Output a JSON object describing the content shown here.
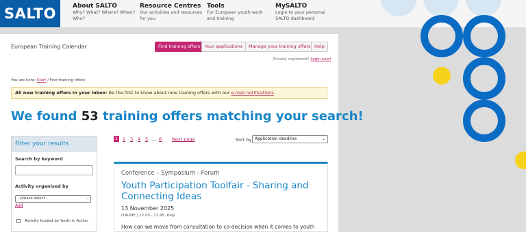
{
  "brand": {
    "logo_text": "SALTO",
    "color": "#0a5ea8",
    "accent": "#c42670",
    "link": "#1a86c8"
  },
  "nav": [
    {
      "title": "About SALTO",
      "sub1": "Why? What? Where? When?",
      "sub2": "Who?"
    },
    {
      "title": "Resource Centres",
      "sub1": "Our activities and resources",
      "sub2": "for you"
    },
    {
      "title": "Tools",
      "sub1": "For European youth work",
      "sub2": "and training"
    },
    {
      "title": "MySALTO",
      "sub1": "Login to your personal",
      "sub2": "SALTO dashboard"
    }
  ],
  "page": {
    "section_title": "European Training Calendar",
    "buttons": {
      "find": "Find training offers",
      "applications": "Your applications",
      "manage": "Manage your training offers",
      "help": "Help"
    },
    "registered_text": "Already registered?",
    "login_link": "Login now!",
    "breadcrumb": {
      "prefix": "You are here:",
      "start": "Start",
      "sep": "/",
      "current": "Find training offers"
    },
    "notice": {
      "bold": "All new training offers in your inbox:",
      "text": "Be the first to know about new training offers with our",
      "link": "e-mail notifications",
      "end": "."
    },
    "headline": {
      "pre": "We found",
      "count": "53",
      "post": "training offers matching your search!"
    }
  },
  "filter": {
    "heading": "Filter your results",
    "keyword_label": "Search by keyword",
    "keyword_value": "",
    "organised_label": "Activity organised by",
    "organised_select": "- please select -",
    "add_link": "Add",
    "funded_label": "Activity funded by Youth in Action",
    "funded_checked": false
  },
  "pagination": {
    "pages": [
      "1",
      "2",
      "3",
      "4",
      "5",
      "...",
      "6"
    ],
    "current": "1",
    "next": "Next page"
  },
  "sort": {
    "label": "Sort by",
    "value": "Application deadline"
  },
  "offer": {
    "category": "Conference – Symposium - Forum",
    "title": "Youth Participation Toolfair - Sharing and Connecting Ideas",
    "date": "13 November 2025",
    "meta": "ONLINE | 12.00 - 13.45, Italy",
    "description": "How can we move from consultation to co-decision when it comes to youth"
  }
}
